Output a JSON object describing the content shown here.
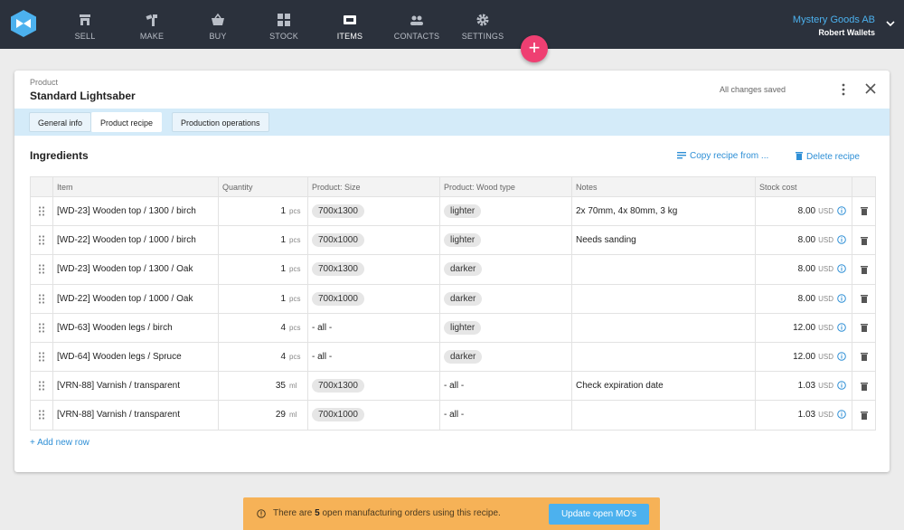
{
  "nav": {
    "items": [
      {
        "label": "SELL",
        "icon": "shop-icon"
      },
      {
        "label": "MAKE",
        "icon": "make-icon"
      },
      {
        "label": "BUY",
        "icon": "basket-icon"
      },
      {
        "label": "STOCK",
        "icon": "stock-icon"
      },
      {
        "label": "ITEMS",
        "icon": "items-icon"
      },
      {
        "label": "CONTACTS",
        "icon": "contacts-icon"
      },
      {
        "label": "SETTINGS",
        "icon": "gear-icon"
      }
    ],
    "active": "ITEMS",
    "company": "Mystery Goods AB",
    "user": "Robert Wallets",
    "fab_label": "+"
  },
  "card": {
    "breadcrumb": "Product",
    "title": "Standard Lightsaber",
    "save_status": "All changes saved",
    "tabs": [
      {
        "label": "General info"
      },
      {
        "label": "Product recipe"
      },
      {
        "label": "Production operations"
      }
    ],
    "active_tab": "Product recipe"
  },
  "ingredients": {
    "title": "Ingredients",
    "copy_label": "Copy recipe from ...",
    "delete_label": "Delete recipe",
    "columns": [
      "Item",
      "Quantity",
      "Product: Size",
      "Product: Wood type",
      "Notes",
      "Stock cost"
    ],
    "rows": [
      {
        "item": "[WD-23] Wooden top / 1300 / birch",
        "qty": "1",
        "unit": "pcs",
        "size": "700x1300",
        "wood": "lighter",
        "notes": "2x 70mm, 4x 80mm, 3 kg",
        "cost": "8.00",
        "currency": "USD"
      },
      {
        "item": "[WD-22] Wooden top / 1000 / birch",
        "qty": "1",
        "unit": "pcs",
        "size": "700x1000",
        "wood": "lighter",
        "notes": "Needs sanding",
        "cost": "8.00",
        "currency": "USD"
      },
      {
        "item": "[WD-23] Wooden top / 1300 / Oak",
        "qty": "1",
        "unit": "pcs",
        "size": "700x1300",
        "wood": "darker",
        "notes": "",
        "cost": "8.00",
        "currency": "USD"
      },
      {
        "item": "[WD-22] Wooden top / 1000 / Oak",
        "qty": "1",
        "unit": "pcs",
        "size": "700x1000",
        "wood": "darker",
        "notes": "",
        "cost": "8.00",
        "currency": "USD"
      },
      {
        "item": "[WD-63] Wooden legs / birch",
        "qty": "4",
        "unit": "pcs",
        "size": "- all -",
        "wood": "lighter",
        "notes": "",
        "cost": "12.00",
        "currency": "USD"
      },
      {
        "item": "[WD-64] Wooden legs / Spruce",
        "qty": "4",
        "unit": "pcs",
        "size": "- all -",
        "wood": "darker",
        "notes": "",
        "cost": "12.00",
        "currency": "USD"
      },
      {
        "item": "[VRN-88] Varnish / transparent",
        "qty": "35",
        "unit": "ml",
        "size": "700x1300",
        "wood": "- all -",
        "notes": "Check expiration date",
        "cost": "1.03",
        "currency": "USD"
      },
      {
        "item": "[VRN-88] Varnish / transparent",
        "qty": "29",
        "unit": "ml",
        "size": "700x1000",
        "wood": "- all -",
        "notes": "",
        "cost": "1.03",
        "currency": "USD"
      }
    ],
    "add_row_label": "+ Add new row"
  },
  "notice": {
    "prefix": "There are",
    "count": "5",
    "suffix": "open manufacturing orders using this recipe.",
    "button_label": "Update open MO's"
  },
  "colors": {
    "topbar": "#2b313c",
    "accent": "#4cb1ee",
    "fab": "#ef3f72",
    "tabbar": "#d4ebf9",
    "notice": "#f6b257"
  }
}
